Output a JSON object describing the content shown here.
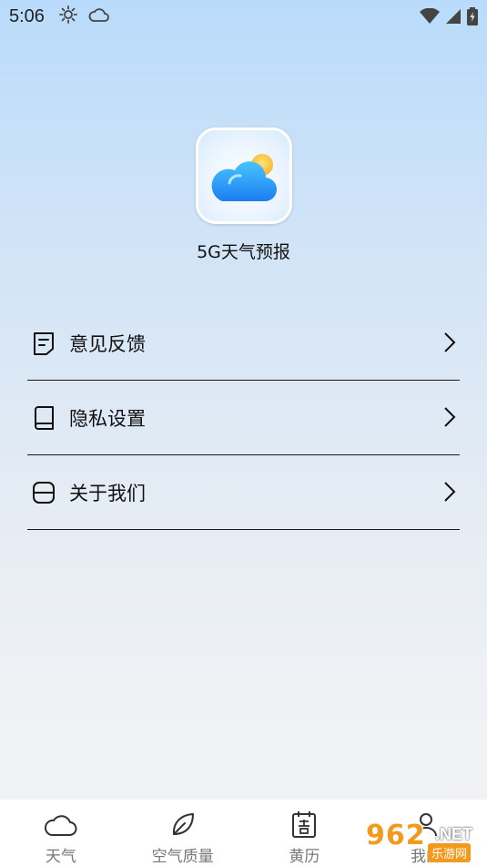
{
  "status_bar": {
    "time": "5:06",
    "icons": [
      "sun-icon",
      "cloud-icon",
      "wifi-icon",
      "signal-icon",
      "battery-icon"
    ]
  },
  "app": {
    "name": "5G天气预报",
    "logo_icon": "cloud-sun-icon"
  },
  "menu": {
    "items": [
      {
        "label": "意见反馈",
        "icon": "feedback-note-icon"
      },
      {
        "label": "隐私设置",
        "icon": "book-icon"
      },
      {
        "label": "关于我们",
        "icon": "box-icon"
      }
    ]
  },
  "bottom_nav": {
    "items": [
      {
        "label": "天气",
        "icon": "cloud-icon"
      },
      {
        "label": "空气质量",
        "icon": "leaf-icon"
      },
      {
        "label": "黄历",
        "icon": "calendar-icon"
      },
      {
        "label": "我的",
        "icon": "user-icon"
      }
    ]
  },
  "watermark": {
    "number": "962",
    "suffix": ".NET",
    "sub": "乐游网"
  },
  "colors": {
    "bg_top": "#b9dbfb",
    "bg_bottom": "#f3f3f4",
    "watermark_orange": "#f39a1c",
    "nav_label": "#777777"
  }
}
